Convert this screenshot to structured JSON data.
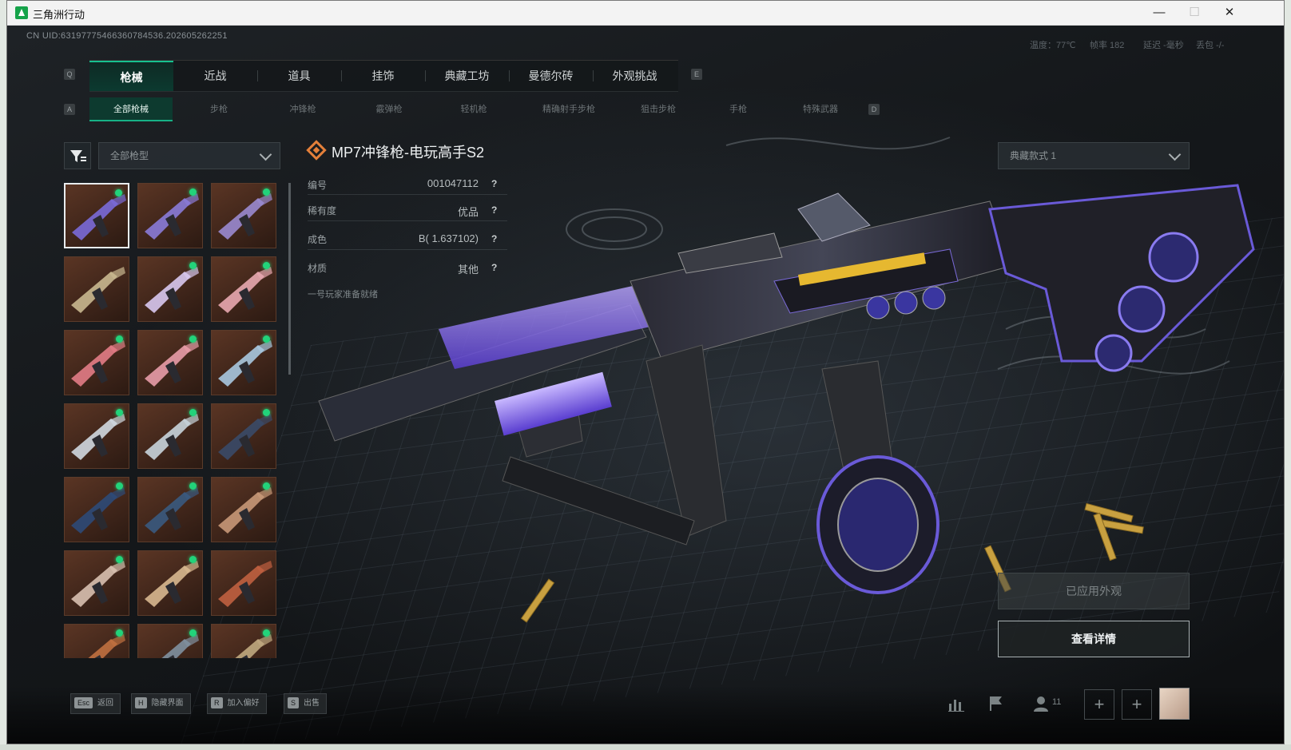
{
  "window": {
    "title": "三角洲行动",
    "minimize": "—",
    "maximize": "☐",
    "close": "✕"
  },
  "uid": "CN UID:63197775466360784536.202605262251",
  "system_info": {
    "temp": "温度：77℃",
    "fps": "帧率 182",
    "latency": "延迟 -毫秒",
    "loss": "丢包 -/-"
  },
  "main_tabs": [
    "枪械",
    "近战",
    "道具",
    "挂饰",
    "典藏工坊",
    "曼德尔砖",
    "外观挑战"
  ],
  "key_hints": {
    "prev_tab": "Q",
    "next_tab": "E",
    "prev_sub": "A",
    "next_sub": "D"
  },
  "sub_tabs": [
    "全部枪械",
    "步枪",
    "冲锋枪",
    "霰弹枪",
    "轻机枪",
    "精确射手步枪",
    "狙击步枪",
    "手枪",
    "特殊武器"
  ],
  "filter": {
    "value": "全部枪型"
  },
  "variant_select": {
    "value": "典藏款式 1"
  },
  "weapon": {
    "name": "MP7冲锋枪-电玩高手S2",
    "stats": [
      {
        "label": "编号",
        "value": "001047112"
      },
      {
        "label": "稀有度",
        "value": "优品"
      },
      {
        "label": "成色",
        "value": "B( 1.637102)"
      },
      {
        "label": "材质",
        "value": "其他"
      }
    ],
    "ready_text": "一号玩家准备就绪"
  },
  "colors": {
    "accent": "#18c08f",
    "new_dot": "#22d37a",
    "title_icon": "#e4803a"
  },
  "buttons": {
    "applied": "已应用外观",
    "details": "查看详情"
  },
  "bottom_actions": [
    {
      "key": "Esc",
      "label": "返回"
    },
    {
      "key": "H",
      "label": "隐藏界面"
    },
    {
      "key": "R",
      "label": "加入偏好"
    },
    {
      "key": "S",
      "label": "出售"
    }
  ],
  "team_count": "11",
  "plus_label": "+",
  "skins": [
    {
      "tint": "#7a6ad8",
      "new": true
    },
    {
      "tint": "#8a7bd8",
      "new": true
    },
    {
      "tint": "#9a8ad0",
      "new": true
    },
    {
      "tint": "#c9b890",
      "new": false
    },
    {
      "tint": "#d8c8f0",
      "new": true
    },
    {
      "tint": "#e8a8b0",
      "new": true
    },
    {
      "tint": "#e27c86",
      "new": true
    },
    {
      "tint": "#e89ca8",
      "new": true
    },
    {
      "tint": "#a8c8e0",
      "new": true
    },
    {
      "tint": "#d0d8e0",
      "new": true
    },
    {
      "tint": "#c8d4dc",
      "new": true
    },
    {
      "tint": "#3a4a68",
      "new": true
    },
    {
      "tint": "#2e4a78",
      "new": true
    },
    {
      "tint": "#3a5a80",
      "new": true
    },
    {
      "tint": "#c89878",
      "new": true
    },
    {
      "tint": "#d8c0b0",
      "new": true
    },
    {
      "tint": "#d8b890",
      "new": true
    },
    {
      "tint": "#c06040",
      "new": false
    },
    {
      "tint": "#c07040",
      "new": true
    },
    {
      "tint": "#8090a0",
      "new": true
    },
    {
      "tint": "#c0a880",
      "new": true
    }
  ]
}
